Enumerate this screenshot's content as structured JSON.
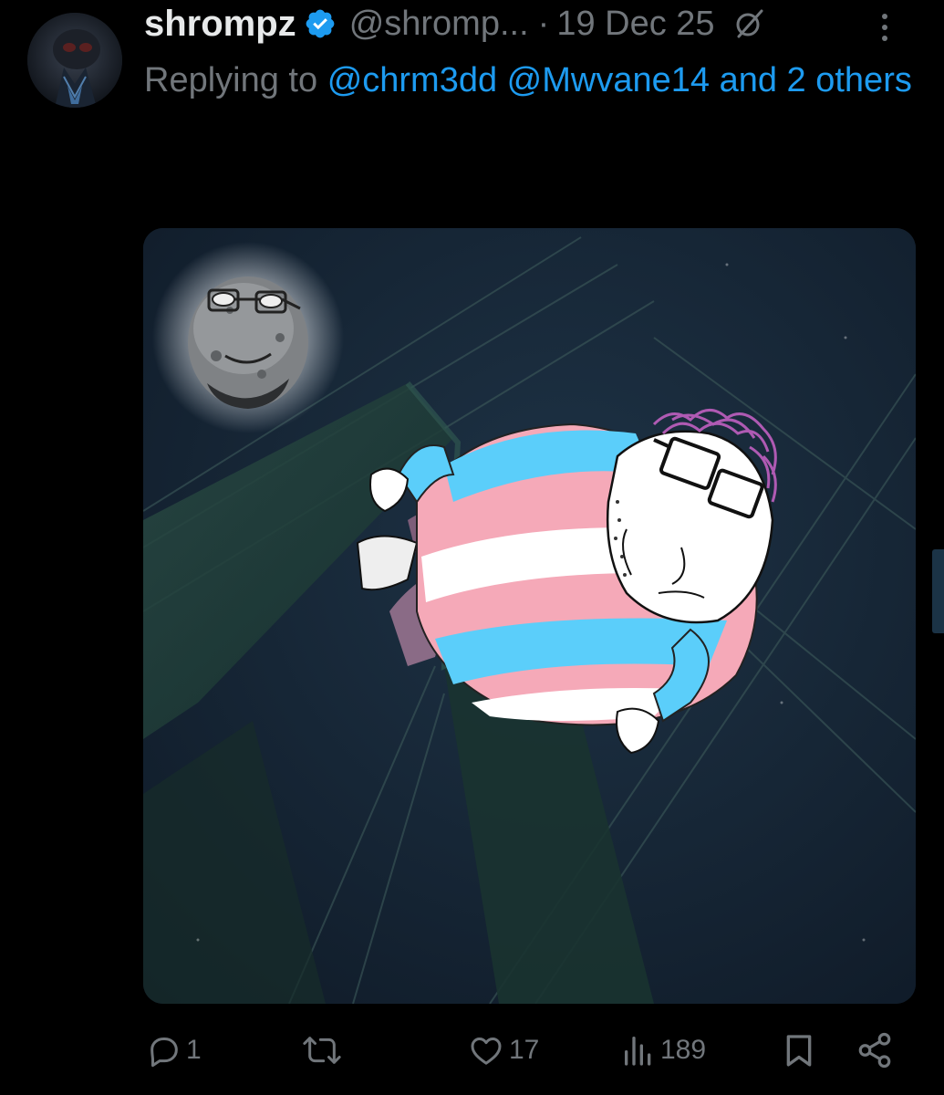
{
  "post": {
    "display_name": "shrompz",
    "handle": "@shromp...",
    "separator": "·",
    "date": "19 Dec 25",
    "reply": {
      "prefix": "Replying to",
      "mention_1": "@chrm3dd",
      "mention_2": "@Mwvane14",
      "suffix": "and 2 others"
    },
    "media_alt": "Meme image: a cartoon character in a pink, white and light blue striped sweater falling beneath a bridge at night, with a bearded face drawn as the moon",
    "stats": {
      "replies": "1",
      "reposts": "",
      "likes": "17",
      "views": "189"
    }
  },
  "icons": {
    "verified": "verified-badge-icon",
    "grok": "grok-icon",
    "more": "more-options-icon",
    "reply": "reply-icon",
    "repost": "repost-icon",
    "like": "like-icon",
    "views": "views-icon",
    "bookmark": "bookmark-icon",
    "share": "share-icon"
  },
  "colors": {
    "background": "#000000",
    "primary_text": "#e7e9ea",
    "secondary_text": "#71767b",
    "link": "#1d9bf0",
    "verified": "#1d9bf0"
  }
}
